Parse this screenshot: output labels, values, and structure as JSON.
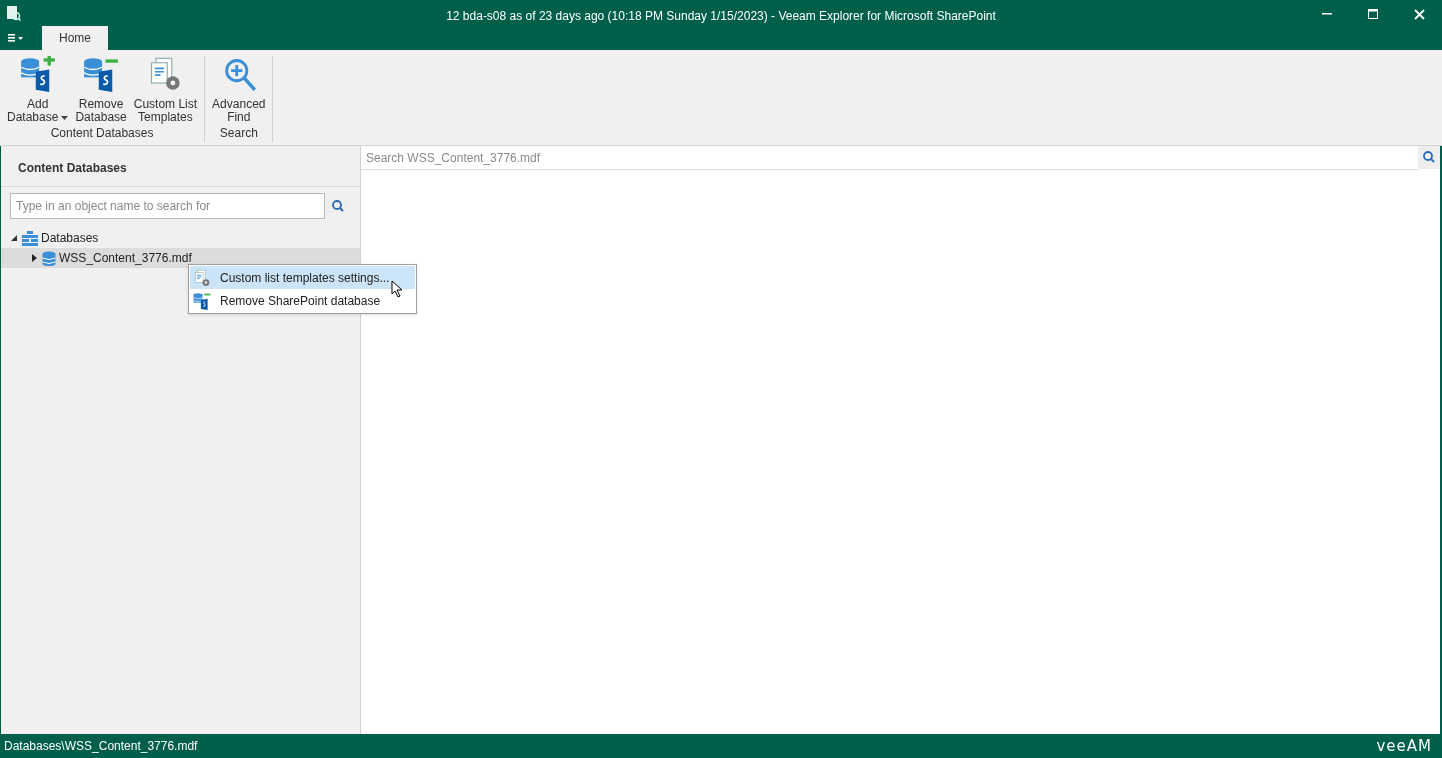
{
  "window": {
    "title": "12 bda-s08 as of 23 days ago (10:18 PM Sunday 1/15/2023) - Veeam Explorer for Microsoft SharePoint"
  },
  "tabs": [
    {
      "label": "Home",
      "selected": true
    }
  ],
  "ribbon": [
    {
      "label": "Content Databases",
      "buttons": [
        {
          "kind": "add",
          "lines": [
            "Add",
            "Database"
          ],
          "dropdown": true
        },
        {
          "kind": "remove",
          "lines": [
            "Remove",
            "Database"
          ],
          "dropdown": false
        },
        {
          "kind": "templates",
          "lines": [
            "Custom List",
            "Templates"
          ],
          "dropdown": false
        }
      ]
    },
    {
      "label": "Search",
      "buttons": [
        {
          "kind": "find",
          "lines": [
            "Advanced",
            "Find"
          ],
          "dropdown": false
        }
      ]
    }
  ],
  "sidebar": {
    "title": "Content Databases",
    "search": {
      "placeholder": "Type in an object name to search for"
    },
    "tree": [
      {
        "label": "Databases",
        "expanded": true,
        "selected": false,
        "children": [
          {
            "label": "WSS_Content_3776.mdf",
            "expanded": false,
            "selected": true
          }
        ]
      }
    ]
  },
  "context_menu": [
    {
      "kind": "templates",
      "label": "Custom list templates settings...",
      "selected": true
    },
    {
      "kind": "remove",
      "label": "Remove SharePoint database",
      "selected": false
    }
  ],
  "content": {
    "search": {
      "placeholder": "Search WSS_Content_3776.mdf"
    }
  },
  "status_bar": {
    "path": "Databases\\WSS_Content_3776.mdf",
    "logo": "veeAM"
  }
}
